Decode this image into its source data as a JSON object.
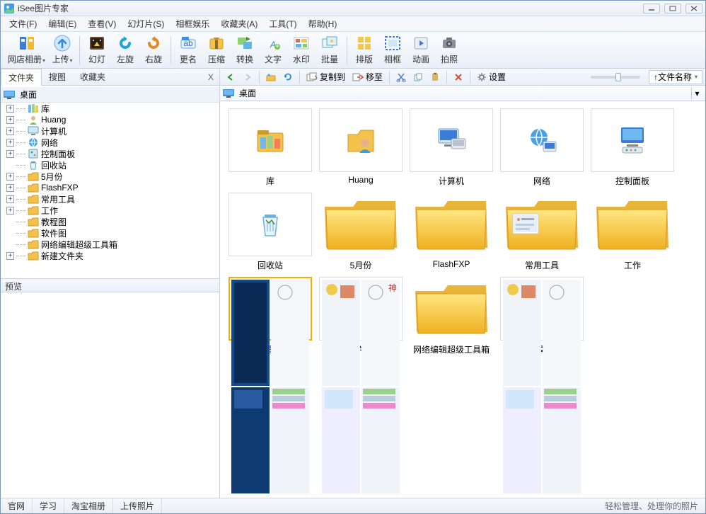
{
  "window": {
    "title": "iSee图片专家"
  },
  "menu": {
    "file": "文件(F)",
    "edit": "编辑(E)",
    "view": "查看(V)",
    "slide": "幻灯片(S)",
    "frame": "相框娱乐",
    "fav": "收藏夹(A)",
    "tools": "工具(T)",
    "help": "帮助(H)"
  },
  "toolbar": {
    "album": "网店相册",
    "upload": "上传",
    "slideshow": "幻灯",
    "rotleft": "左旋",
    "rotright": "右旋",
    "rename": "更名",
    "compress": "压缩",
    "convert": "转换",
    "text": "文字",
    "watermark": "水印",
    "batch": "批量",
    "layout": "排版",
    "photoframe": "相框",
    "animation": "动画",
    "capture": "拍照"
  },
  "lefttabs": {
    "folders": "文件夹",
    "search": "搜图",
    "favorites": "收藏夹",
    "close": "X"
  },
  "tree": {
    "root": "桌面",
    "items": [
      {
        "label": "库",
        "icon": "libraries",
        "expandable": true
      },
      {
        "label": "Huang",
        "icon": "user",
        "expandable": true
      },
      {
        "label": "计算机",
        "icon": "computer",
        "expandable": true
      },
      {
        "label": "网络",
        "icon": "network",
        "expandable": true
      },
      {
        "label": "控制面板",
        "icon": "control",
        "expandable": true
      },
      {
        "label": "回收站",
        "icon": "recycle",
        "expandable": false
      },
      {
        "label": "5月份",
        "icon": "folder",
        "expandable": true
      },
      {
        "label": "FlashFXP",
        "icon": "folder",
        "expandable": true
      },
      {
        "label": "常用工具",
        "icon": "folder",
        "expandable": true
      },
      {
        "label": "工作",
        "icon": "folder",
        "expandable": true
      },
      {
        "label": "教程图",
        "icon": "folder",
        "expandable": false
      },
      {
        "label": "软件图",
        "icon": "folder",
        "expandable": false
      },
      {
        "label": "网络编辑超级工具箱",
        "icon": "folder",
        "expandable": false
      },
      {
        "label": "新建文件夹",
        "icon": "folder",
        "expandable": true
      }
    ]
  },
  "preview": {
    "header": "预览"
  },
  "righttb": {
    "copyto": "复制到",
    "moveto": "移至",
    "settings": "设置",
    "sort": "↑文件名称"
  },
  "breadcrumb": {
    "location": "桌面"
  },
  "grid": {
    "items": [
      {
        "label": "库",
        "kind": "libraries"
      },
      {
        "label": "Huang",
        "kind": "user"
      },
      {
        "label": "计算机",
        "kind": "computer"
      },
      {
        "label": "网络",
        "kind": "network"
      },
      {
        "label": "控制面板",
        "kind": "control"
      },
      {
        "label": "回收站",
        "kind": "recycle"
      },
      {
        "label": "5月份",
        "kind": "folder"
      },
      {
        "label": "FlashFXP",
        "kind": "folder"
      },
      {
        "label": "常用工具",
        "kind": "folder-thumb"
      },
      {
        "label": "工作",
        "kind": "folder"
      },
      {
        "label": "教程图",
        "kind": "folder-photos",
        "selected": true
      },
      {
        "label": "软件图",
        "kind": "folder-photos2"
      },
      {
        "label": "网络编辑超级工具箱",
        "kind": "folder"
      },
      {
        "label": "新建文件夹",
        "kind": "folder-photos3"
      }
    ]
  },
  "status": {
    "tabs": [
      "官网",
      "学习",
      "淘宝相册",
      "上传照片"
    ],
    "tip": "轻松管理、处理你的照片"
  }
}
